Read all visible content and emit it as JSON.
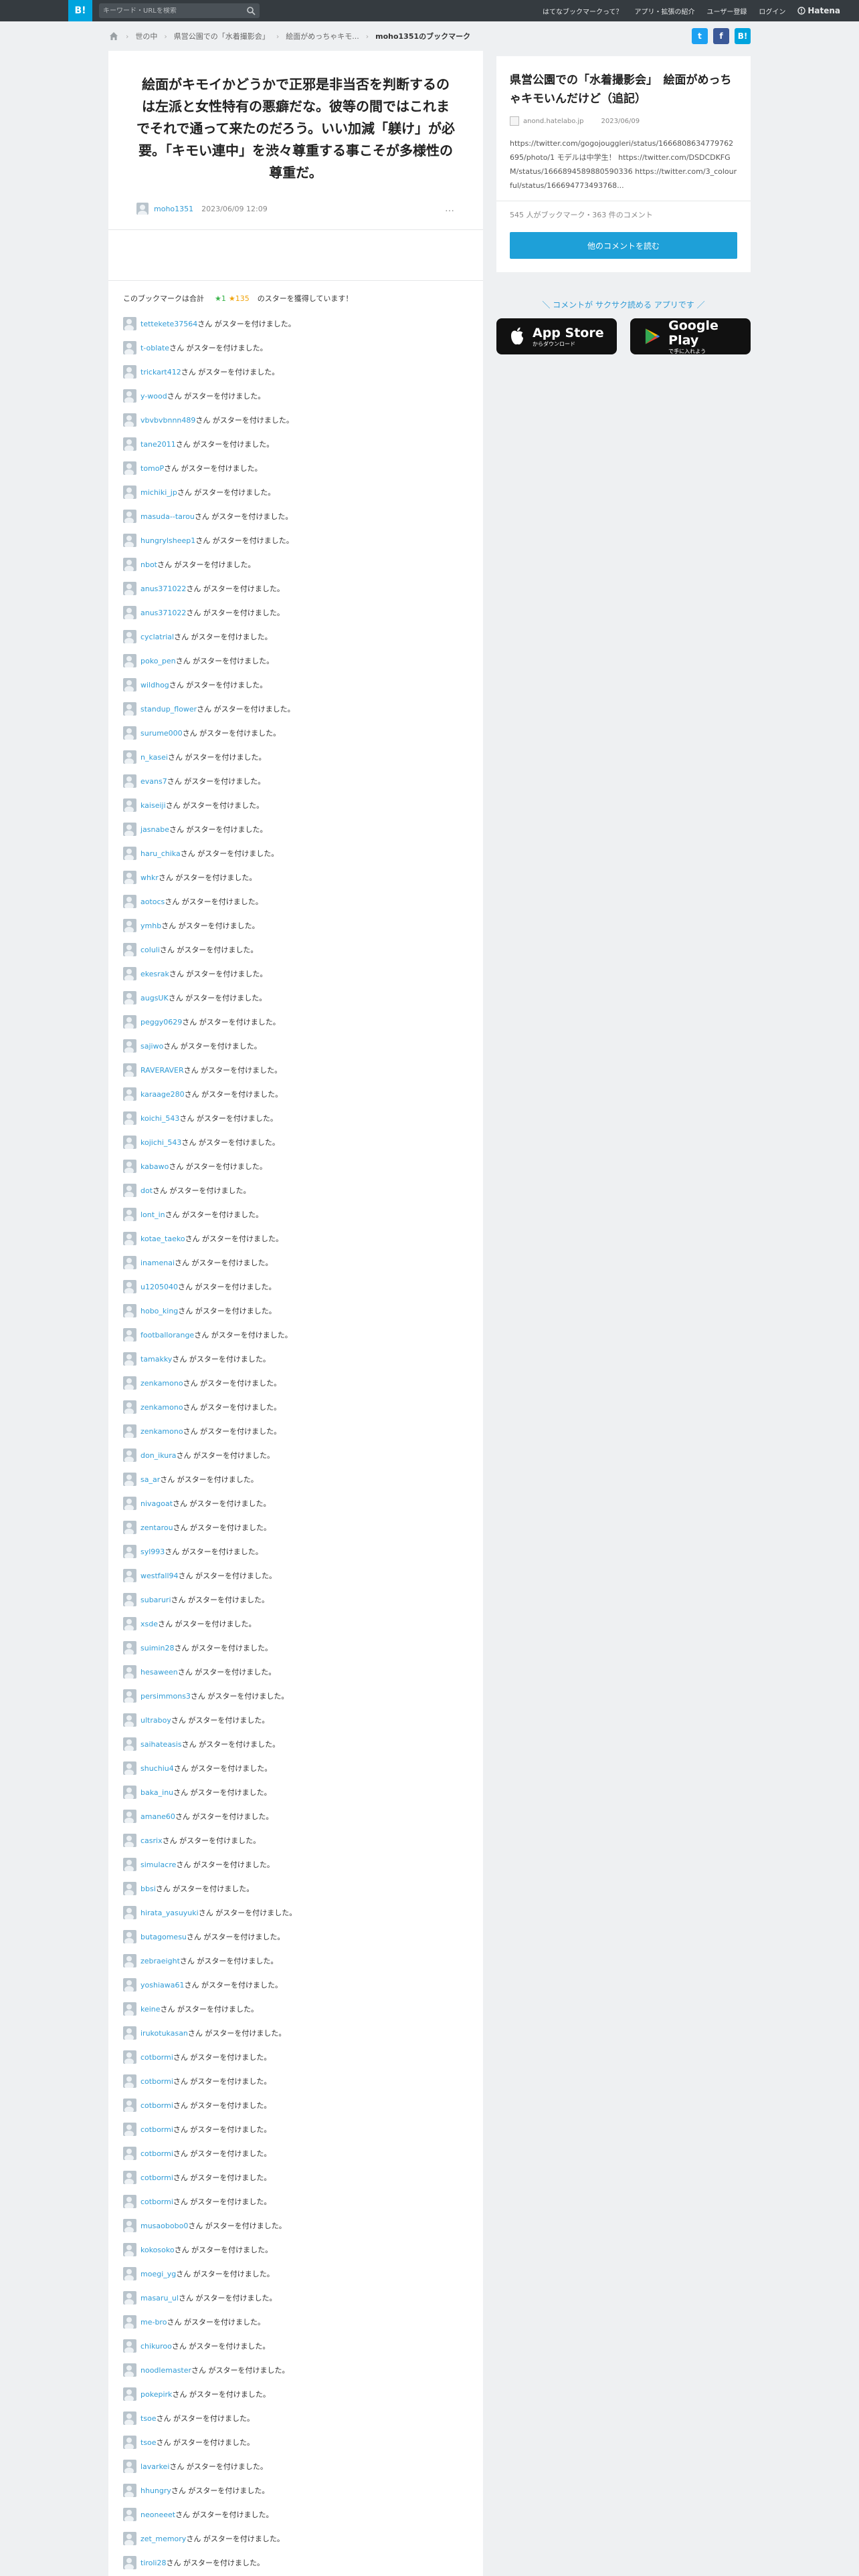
{
  "header": {
    "logo": "B!",
    "search_placeholder": "キーワード・URLを検索",
    "nav": [
      "はてなブックマークって？",
      "アプリ・拡張の紹介",
      "ユーザー登録",
      "ログイン"
    ],
    "brand": "Hatena"
  },
  "breadcrumb": [
    "世の中",
    "県営公園での「水着撮影会」",
    "絵面がめっちゃキモ...",
    "moho1351のブックマーク"
  ],
  "share": {
    "twitter": "t",
    "facebook": "f",
    "hatebu": "B!"
  },
  "comment": {
    "text": "絵面がキモイかどうかで正邪是非当否を判断するのは左派と女性特有の悪癖だな。彼等の間ではこれまでそれで通って来たのだろう。いい加減「躾け」が必要。「キモい連中」を渋々尊重する事こそが多様性の尊重だ。",
    "user": "moho1351",
    "date": "2023/06/09 12:09",
    "more": "…"
  },
  "stars": {
    "summary_prefix": "このブックマークは合計",
    "green": "1",
    "yellow": "135",
    "summary_suffix": "のスターを獲得しています！",
    "suffix": "さん がスターを付けました。",
    "users": [
      "tettekete37564",
      "t-oblate",
      "trickart412",
      "y-wood",
      "vbvbvbnnn489",
      "tane2011",
      "tomoP",
      "michiki_jp",
      "masuda--tarou",
      "hungrylsheep1",
      "nbot",
      "anus371022",
      "anus371022",
      "cyclatrial",
      "poko_pen",
      "wildhog",
      "standup_flower",
      "surume000",
      "n_kasei",
      "evans7",
      "kaiseiji",
      "jasnabe",
      "haru_chika",
      "whkr",
      "aotocs",
      "ymhb",
      "coluli",
      "ekesrak",
      "augsUK",
      "peggy0629",
      "sajiwo",
      "RAVERAVER",
      "karaage280",
      "koichi_543",
      "kojichi_543",
      "kabawo",
      "dot",
      "lont_in",
      "kotae_taeko",
      "inamenai",
      "u1205040",
      "hobo_king",
      "footballorange",
      "tamakky",
      "zenkamono",
      "zenkamono",
      "zenkamono",
      "don_ikura",
      "sa_ar",
      "nivagoat",
      "zentarou",
      "syl993",
      "westfall94",
      "subaruri",
      "xsde",
      "suimin28",
      "hesaween",
      "persimmons3",
      "ultraboy",
      "saihateasis",
      "shuchiu4",
      "baka_inu",
      "amane60",
      "casrix",
      "simulacre",
      "bbsi",
      "hirata_yasuyuki",
      "butagomesu",
      "zebraeight",
      "yoshiawa61",
      "keine",
      "irukotukasan",
      "cotbormi",
      "cotbormi",
      "cotbormi",
      "cotbormi",
      "cotbormi",
      "cotbormi",
      "cotbormi",
      "musaobobo0",
      "kokosoko",
      "moegi_yg",
      "masaru_ul",
      "me-bro",
      "chikuroo",
      "noodlemaster",
      "pokepirk",
      "tsoe",
      "tsoe",
      "lavarkei",
      "hhungry",
      "neoneeet",
      "zet_memory",
      "tiroli28"
    ]
  },
  "side": {
    "title": "県営公園での「水着撮影会」　絵面がめっちゃキモいんだけど（追記）",
    "source": "anond.hatelabo.jp",
    "source_date": "2023/06/09",
    "excerpt": "https://twitter.com/gogojouggleri/status/1666808634779762695/photo/1 モデルは中学生！ https://twitter.com/DSDCDKFGM/status/1666894589880590336 https://twitter.com/3_colourful/status/166694773493768...",
    "stats": "545 人がブックマーク・363 件のコメント",
    "button": "他のコメントを読む",
    "promo": "＼ コメントが サクサク読める アプリです ／",
    "appstore_small": "からダウンロード",
    "appstore_big": "App Store",
    "googleplay_small": "で手に入れよう",
    "googleplay_big": "Google Play"
  }
}
